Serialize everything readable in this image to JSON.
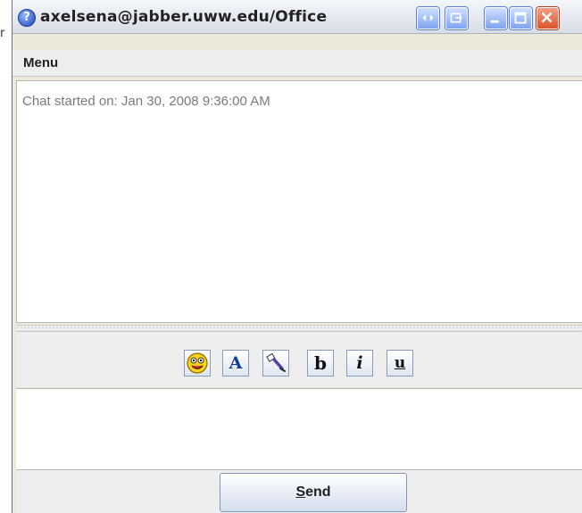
{
  "window": {
    "title": "axelsena@jabber.uww.edu/Office",
    "app_icon_glyph": "?"
  },
  "menubar": {
    "menu_label": "Menu"
  },
  "transcript": {
    "chat_started_label": "Chat started on:",
    "chat_started_time": "Jan 30, 2008 9:36:00 AM"
  },
  "toolbar": {
    "buttons": [
      {
        "name": "emoticon",
        "glyph": "☺"
      },
      {
        "name": "font",
        "glyph": "A"
      },
      {
        "name": "text-color",
        "glyph": "✎"
      },
      {
        "name": "bold",
        "glyph": "b"
      },
      {
        "name": "italic",
        "glyph": "i"
      },
      {
        "name": "underline",
        "glyph": "u"
      }
    ]
  },
  "send": {
    "mnemonic": "S",
    "rest": "end"
  },
  "background": {
    "left_fragment": "r"
  }
}
